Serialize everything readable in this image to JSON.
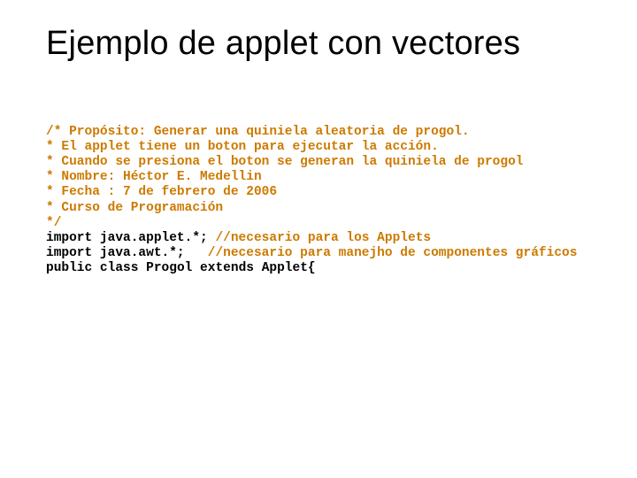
{
  "title": "Ejemplo de applet con vectores",
  "code": {
    "c1": "/* Propósito: Generar una quiniela aleatoria de progol.",
    "c2": "* El applet tiene un boton para ejecutar la acción.",
    "c3": "* Cuando se presiona el boton se generan la quiniela de progol",
    "c4": "* Nombre: Héctor E. Medellin",
    "c5": "* Fecha : 7 de febrero de 2006",
    "c6": "* Curso de Programación",
    "c7": "*/",
    "imp": "import",
    "pkg1": " java.applet.*; ",
    "cm1": "//necesario para los Applets",
    "pkg2": " java.awt.*;   ",
    "cm2": "//necesario para manejho de componentes gráficos",
    "pub": "public",
    "cls": " class ",
    "name": "Progol",
    "ext": " extends ",
    "sup": "Applet{"
  }
}
